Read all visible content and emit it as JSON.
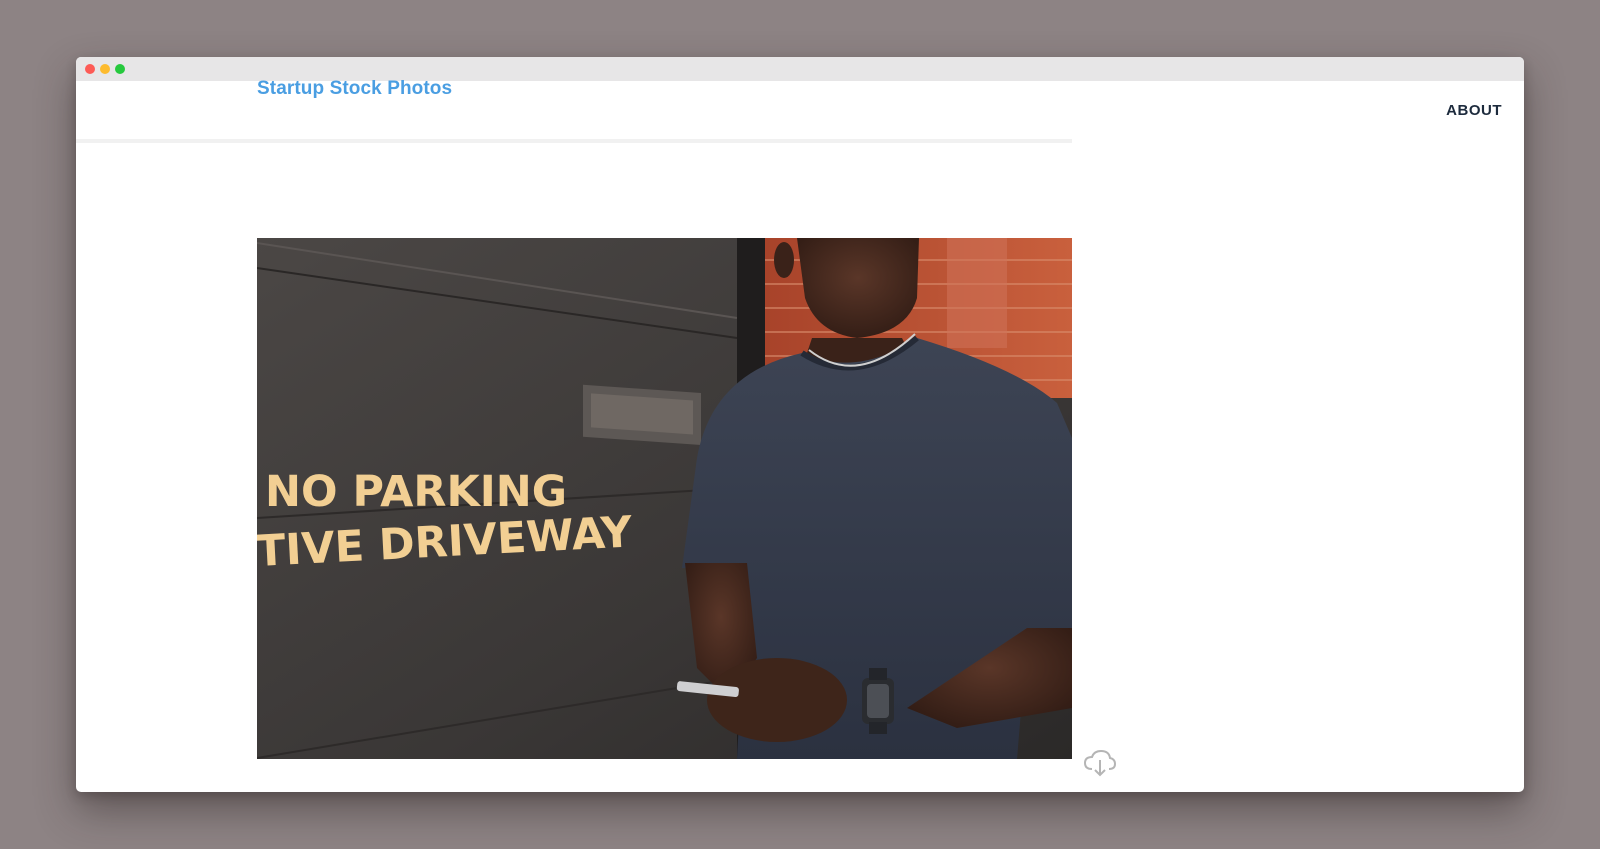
{
  "window": {
    "controls": [
      "close",
      "minimize",
      "maximize"
    ]
  },
  "header": {
    "brand": "Startup Stock Photos",
    "nav": {
      "about_label": "ABOUT"
    }
  },
  "photo": {
    "sign_line_1": "NO PARKING",
    "sign_line_2": "TIVE DRIVEWAY"
  },
  "actions": {
    "download_icon": "cloud-download-icon"
  },
  "colors": {
    "brand": "#4a9ee2",
    "nav": "#1d2b3d",
    "backdrop": "#8d8384"
  }
}
